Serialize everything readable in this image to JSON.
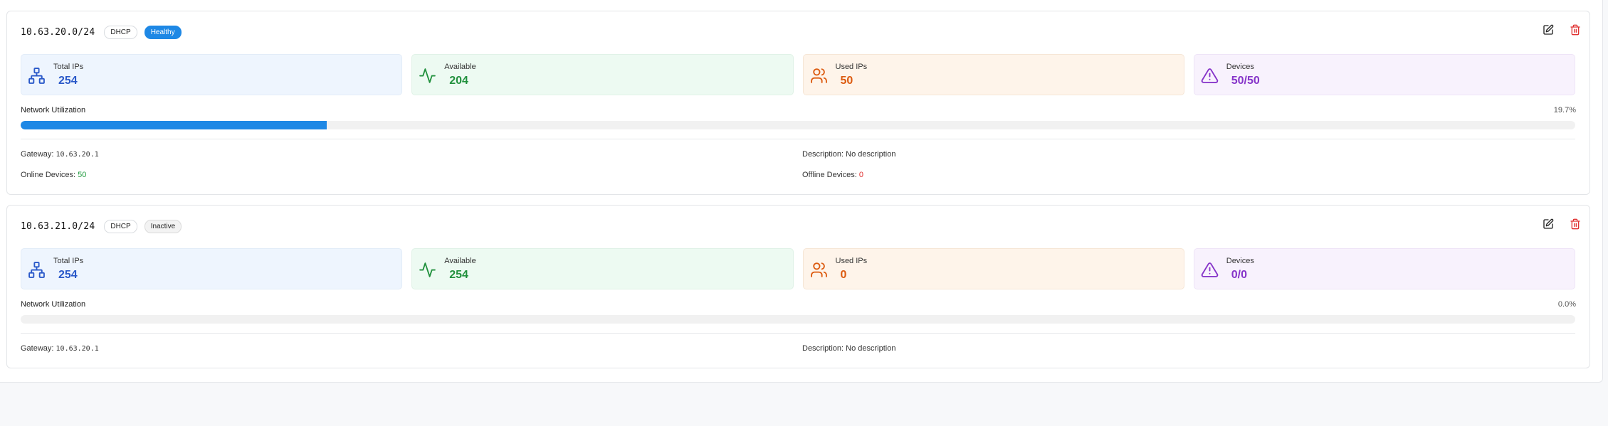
{
  "subnets": [
    {
      "cidr": "10.63.20.0/24",
      "type_badge": "DHCP",
      "status_badge": "Healthy",
      "stats": {
        "total": {
          "label": "Total IPs",
          "value": "254"
        },
        "available": {
          "label": "Available",
          "value": "204"
        },
        "used": {
          "label": "Used IPs",
          "value": "50"
        },
        "devices": {
          "label": "Devices",
          "value": "50/50"
        }
      },
      "utilization": {
        "label": "Network Utilization",
        "percent_text": "19.7%",
        "fraction": 0.197
      },
      "gateway": {
        "label": "Gateway:",
        "value": "10.63.20.1"
      },
      "description": {
        "label": "Description:",
        "value": "No description"
      },
      "online": {
        "label": "Online Devices:",
        "value": "50"
      },
      "offline": {
        "label": "Offline Devices:",
        "value": "0"
      }
    },
    {
      "cidr": "10.63.21.0/24",
      "type_badge": "DHCP",
      "status_badge": "Inactive",
      "stats": {
        "total": {
          "label": "Total IPs",
          "value": "254"
        },
        "available": {
          "label": "Available",
          "value": "254"
        },
        "used": {
          "label": "Used IPs",
          "value": "0"
        },
        "devices": {
          "label": "Devices",
          "value": "0/0"
        }
      },
      "utilization": {
        "label": "Network Utilization",
        "percent_text": "0.0%",
        "fraction": 0.0
      },
      "gateway": {
        "label": "Gateway:",
        "value": "10.63.20.1"
      },
      "description": {
        "label": "Description:",
        "value": "No description"
      }
    }
  ],
  "icons": {
    "total": "network-icon",
    "available": "activity-icon",
    "used": "users-icon",
    "devices": "warning-icon",
    "edit": "edit-icon",
    "delete": "trash-icon"
  },
  "colors": {
    "accent": "#1e88e5",
    "available": "#22913e",
    "used": "#dc5a0f",
    "devices": "#8634c9",
    "total": "#2a59c9",
    "delete": "#e03131"
  }
}
